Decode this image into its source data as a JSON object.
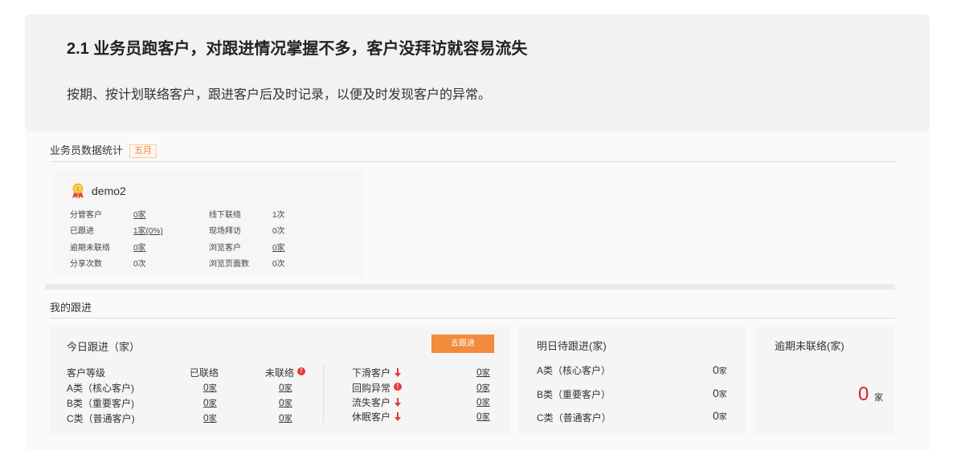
{
  "banner": {
    "title": "2.1 业务员跑客户，对跟进情况掌握不多，客户没拜访就容易流失",
    "subtitle": "按期、按计划联络客户，跟进客户后及时记录，以便及时发现客户的异常。"
  },
  "stats": {
    "title": "业务员数据统计",
    "month": "五月",
    "username": "demo2",
    "rows": [
      {
        "l1": "分管客户",
        "v1": "0家",
        "l2": "线下联络",
        "v2": "1次"
      },
      {
        "l1": "已跟进",
        "v1": "1家(0%)",
        "l2": "现场拜访",
        "v2": "0次"
      },
      {
        "l1": "逾期未联络",
        "v1": "0家",
        "l2": "浏览客户",
        "v2": "0家"
      },
      {
        "l1": "分享次数",
        "v1": "0次",
        "l2": "浏览页面数",
        "v2": "0次"
      }
    ]
  },
  "follow": {
    "title": "我的跟进",
    "today": {
      "title": "今日跟进（家）",
      "button": "去跟进",
      "headers": {
        "level": "客户等级",
        "contacted": "已联络",
        "not_contacted": "未联络"
      },
      "rows": [
        {
          "label": "A类（核心客户)",
          "contacted": "0",
          "not_contacted": "0"
        },
        {
          "label": "B类（重要客户)",
          "contacted": "0",
          "not_contacted": "0"
        },
        {
          "label": "C类（普通客户)",
          "contacted": "0",
          "not_contacted": "0"
        }
      ],
      "right_rows": [
        {
          "label": "下滑客户",
          "value": "0",
          "icon": "arrow-down-icon"
        },
        {
          "label": "回购异常",
          "value": "0",
          "icon": "alert-icon"
        },
        {
          "label": "流失客户",
          "value": "0",
          "icon": "arrow-down-icon"
        },
        {
          "label": "休眠客户",
          "value": "0",
          "icon": "arrow-down-icon"
        }
      ],
      "unit": "家"
    },
    "tomorrow": {
      "title": "明日待跟进(家)",
      "rows": [
        {
          "label": "A类（核心客户）",
          "value": "0"
        },
        {
          "label": "B类（重要客户）",
          "value": "0"
        },
        {
          "label": "C类（普通客户）",
          "value": "0"
        }
      ],
      "unit": "家"
    },
    "overdue": {
      "title": "逾期未联络(家)",
      "value": "0",
      "unit": "家"
    }
  },
  "colors": {
    "accent": "#f28b3c",
    "danger": "#e02020",
    "alert": "#e23a3a"
  }
}
